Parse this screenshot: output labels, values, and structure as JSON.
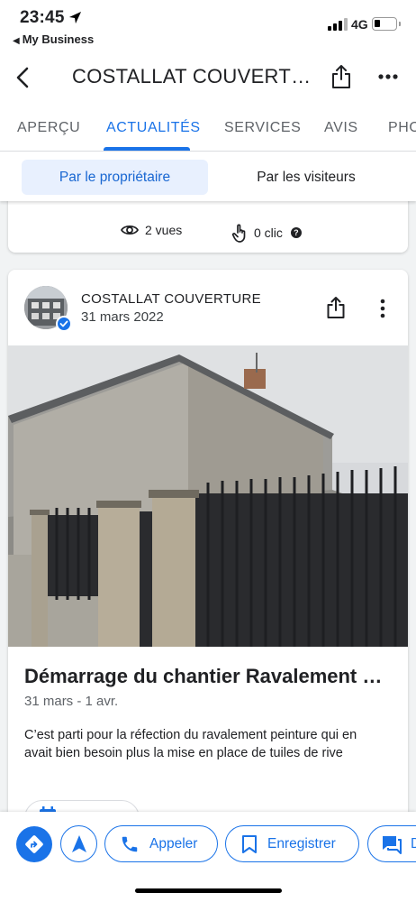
{
  "status_bar": {
    "time": "23:45",
    "back_app": "My Business",
    "network": "4G"
  },
  "app_bar": {
    "title": "COSTALLAT COUVERTURE"
  },
  "tabs": [
    {
      "label": "APERÇU"
    },
    {
      "label": "ACTUALITÉS"
    },
    {
      "label": "SERVICES"
    },
    {
      "label": "AVIS"
    },
    {
      "label": "PHOTOS"
    }
  ],
  "active_tab": "ACTUALITÉS",
  "filter": {
    "owner": "Par le propriétaire",
    "visitors": "Par les visiteurs"
  },
  "stats": {
    "views": "2 vues",
    "clicks": "0 clic",
    "help": "?"
  },
  "post": {
    "business_name": "COSTALLAT COUVERTURE",
    "date": "31 mars 2022",
    "title": "Démarrage du chantier Ravalement peinture",
    "date_range": "31 mars - 1 avr.",
    "text": "C’est parti pour la réfection du ravalement peinture qui en avait bien besoin plus la mise en place de tuiles de rive"
  },
  "actions": {
    "call": "Appeler",
    "save": "Enregistrer",
    "message": "D"
  },
  "colors": {
    "accent": "#1a73e8",
    "active_segment_bg": "#e8f0fe",
    "feed_bg": "#f1f3f4"
  },
  "icons": [
    "location-arrow-icon",
    "back-arrow-icon",
    "share-icon",
    "more-horizontal-icon",
    "eye-icon",
    "touch-icon",
    "help-icon",
    "more-vertical-icon",
    "verified-icon",
    "calendar-icon",
    "directions-icon",
    "navigation-icon",
    "phone-icon",
    "bookmark-icon",
    "message-icon"
  ]
}
